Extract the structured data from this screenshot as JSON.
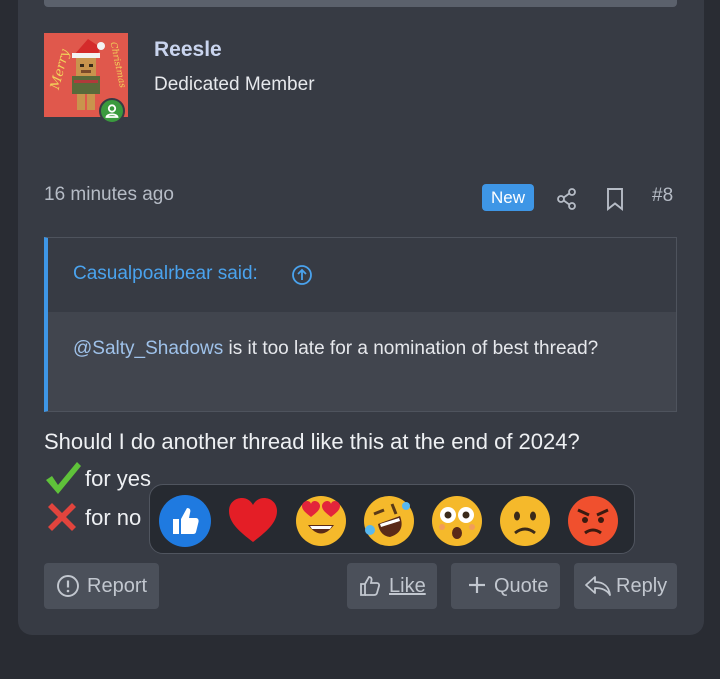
{
  "user": {
    "name": "Reesle",
    "title": "Dedicated Member",
    "avatar_text_left": "Merry",
    "avatar_text_right": "Christmas"
  },
  "post": {
    "time": "16 minutes ago",
    "badge": "New",
    "number": "#8",
    "quote": {
      "author": "Casualpoalrbear said:",
      "mention": "@Salty_Shadows",
      "text": " is it too late for a nomination of best thread?"
    },
    "body": "Should I do another thread like this at the end of 2024?",
    "options": [
      {
        "icon": "check-mark-icon",
        "label": "for yes"
      },
      {
        "icon": "cross-mark-icon",
        "label": "for no"
      }
    ]
  },
  "reactions": [
    {
      "name": "like-reaction-icon",
      "emoji": "👍"
    },
    {
      "name": "love-reaction-icon",
      "emoji": "❤️"
    },
    {
      "name": "heart-eyes-reaction-icon",
      "emoji": "😍"
    },
    {
      "name": "laughing-reaction-icon",
      "emoji": "🤣"
    },
    {
      "name": "astonished-reaction-icon",
      "emoji": "😳"
    },
    {
      "name": "sad-reaction-icon",
      "emoji": "🙁"
    },
    {
      "name": "angry-reaction-icon",
      "emoji": "😡"
    }
  ],
  "actions": {
    "report": "Report",
    "like": "Like",
    "quote": "Quote",
    "reply": "Reply"
  },
  "colors": {
    "accent": "#3e96e6",
    "card": "#373b44",
    "background": "#292c33"
  }
}
